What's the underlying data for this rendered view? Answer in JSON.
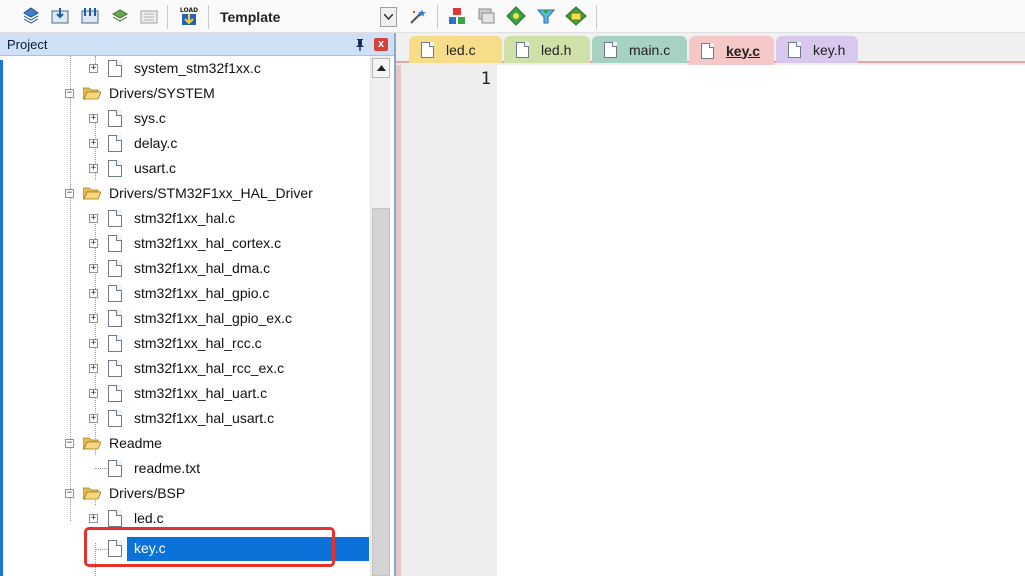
{
  "toolbar": {
    "target_name": "Template",
    "buttons": [
      "build-icon",
      "rebuild-icon",
      "batch-build-icon",
      "translate-icon",
      "stop-build-icon",
      "load-icon",
      "options-icon",
      "manage-components-icon",
      "manage-packs-icon",
      "select-device-icon",
      "pack-installer-icon",
      "environment-icon"
    ],
    "load_text": "LOAD"
  },
  "project_panel": {
    "title": "Project",
    "close_glyph": "x",
    "tree": [
      {
        "label": "system_stm32f1xx.c",
        "type": "file"
      },
      {
        "label": "Drivers/SYSTEM",
        "type": "folder"
      },
      {
        "label": "sys.c",
        "type": "file"
      },
      {
        "label": "delay.c",
        "type": "file"
      },
      {
        "label": "usart.c",
        "type": "file"
      },
      {
        "label": "Drivers/STM32F1xx_HAL_Driver",
        "type": "folder"
      },
      {
        "label": "stm32f1xx_hal.c",
        "type": "file"
      },
      {
        "label": "stm32f1xx_hal_cortex.c",
        "type": "file"
      },
      {
        "label": "stm32f1xx_hal_dma.c",
        "type": "file"
      },
      {
        "label": "stm32f1xx_hal_gpio.c",
        "type": "file"
      },
      {
        "label": "stm32f1xx_hal_gpio_ex.c",
        "type": "file"
      },
      {
        "label": "stm32f1xx_hal_rcc.c",
        "type": "file"
      },
      {
        "label": "stm32f1xx_hal_rcc_ex.c",
        "type": "file"
      },
      {
        "label": "stm32f1xx_hal_uart.c",
        "type": "file"
      },
      {
        "label": "stm32f1xx_hal_usart.c",
        "type": "file"
      },
      {
        "label": "Readme",
        "type": "folder"
      },
      {
        "label": "readme.txt",
        "type": "file"
      },
      {
        "label": "Drivers/BSP",
        "type": "folder"
      },
      {
        "label": "led.c",
        "type": "file"
      },
      {
        "label": "key.c",
        "type": "file",
        "selected": true
      }
    ]
  },
  "editor": {
    "tabs": [
      {
        "label": "led.c",
        "color": "#f7dd8a"
      },
      {
        "label": "led.h",
        "color": "#cfe0a8"
      },
      {
        "label": "main.c",
        "color": "#a7d1c0"
      },
      {
        "label": "key.c",
        "color": "#f6c7c7",
        "active": true
      },
      {
        "label": "key.h",
        "color": "#d9c8ee"
      }
    ],
    "line_number": "1"
  },
  "colors": {
    "selection": "#0a72d8",
    "highlight_box": "#e8312b",
    "panel_header": "#cfe0f6"
  }
}
